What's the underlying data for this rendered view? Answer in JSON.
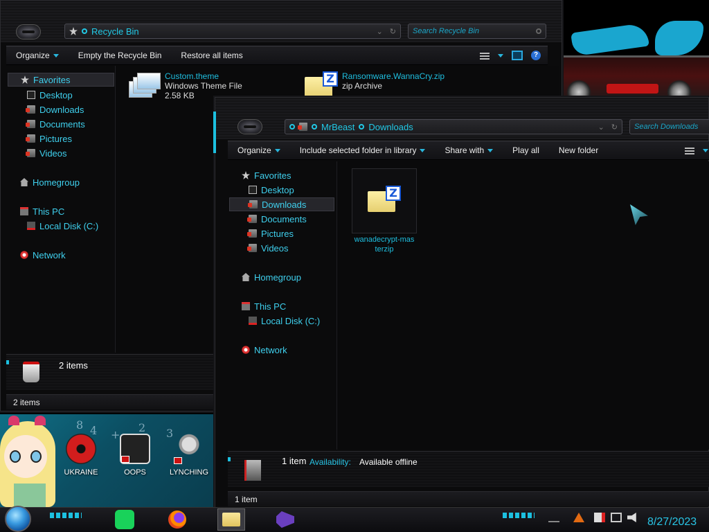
{
  "recycle_window": {
    "address": {
      "path": [
        "Recycle Bin"
      ]
    },
    "search": {
      "placeholder": "Search Recycle Bin"
    },
    "toolbar": {
      "organize": "Organize",
      "empty": "Empty the Recycle Bin",
      "restore": "Restore all items"
    },
    "nav": {
      "favorites": "Favorites",
      "desktop": "Desktop",
      "downloads": "Downloads",
      "documents": "Documents",
      "pictures": "Pictures",
      "videos": "Videos",
      "homegroup": "Homegroup",
      "this_pc": "This PC",
      "local_disk": "Local Disk (C:)",
      "network": "Network"
    },
    "files": [
      {
        "name": "Custom.theme",
        "type": "Windows Theme File",
        "size": "2.58 KB",
        "icon": "theme-icon"
      },
      {
        "name": "Ransomware.WannaCry.zip",
        "type": "zip Archive",
        "icon": "zip-icon"
      }
    ],
    "details": {
      "count": "2 items"
    },
    "status": "2 items"
  },
  "downloads_window": {
    "address": {
      "path": [
        "MrBeast",
        "Downloads"
      ]
    },
    "search": {
      "placeholder": "Search Downloads"
    },
    "toolbar": {
      "organize": "Organize",
      "include": "Include selected folder in library",
      "share": "Share with",
      "play": "Play all",
      "new_folder": "New folder"
    },
    "nav": {
      "favorites": "Favorites",
      "desktop": "Desktop",
      "downloads": "Downloads",
      "documents": "Documents",
      "pictures": "Pictures",
      "videos": "Videos",
      "homegroup": "Homegroup",
      "this_pc": "This PC",
      "local_disk": "Local Disk (C:)",
      "network": "Network"
    },
    "files": [
      {
        "name_line1": "wanadecrypt-mas",
        "name_line2": "terzip",
        "icon": "zip-icon"
      }
    ],
    "details": {
      "count": "1 item",
      "availability_label": "Availability:",
      "availability_value": "Available offline"
    },
    "status": "1 item"
  },
  "desktop": {
    "icons": [
      {
        "label": "UKRAINE",
        "icon": "radiation-icon"
      },
      {
        "label": "OOPS",
        "icon": "oops-icon"
      },
      {
        "label": "LYNCHING",
        "icon": "lynching-icon"
      }
    ],
    "chalk": [
      "8",
      "4",
      "+",
      "2",
      "3"
    ]
  },
  "taskbar": {
    "date": "8/27/2023",
    "apps": [
      "green-app-icon",
      "firefox-icon",
      "file-explorer-icon",
      "visual-studio-icon"
    ],
    "tray": [
      "flame-icon",
      "flag-icon",
      "network-icon",
      "volume-icon"
    ]
  },
  "colors": {
    "accent": "#22c9e6",
    "window_bg": "#0b0b0c",
    "text": "#dddddd"
  }
}
